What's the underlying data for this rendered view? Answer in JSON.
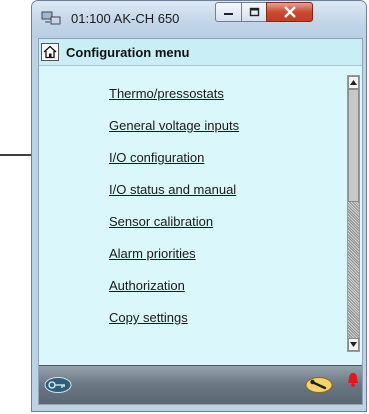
{
  "window": {
    "title": "01:100 AK-CH 650"
  },
  "menu": {
    "title": "Configuration menu",
    "items": [
      {
        "label": "Thermo/pressostats"
      },
      {
        "label": "General voltage inputs"
      },
      {
        "label": "I/O configuration"
      },
      {
        "label": "I/O status and manual"
      },
      {
        "label": "Sensor calibration"
      },
      {
        "label": "Alarm priorities"
      },
      {
        "label": "Authorization"
      },
      {
        "label": "Copy settings"
      }
    ]
  },
  "icons": {
    "app": "network-computer-icon",
    "home": "home-icon",
    "footer_left": "key-lock-icon",
    "footer_right_tool": "wrench-icon",
    "footer_alarm": "alarm-bell-icon"
  },
  "colors": {
    "content_background": "#daf7fb",
    "arrow": "#000000",
    "close_button": "#c94a30",
    "alarm": "#e8141b"
  }
}
